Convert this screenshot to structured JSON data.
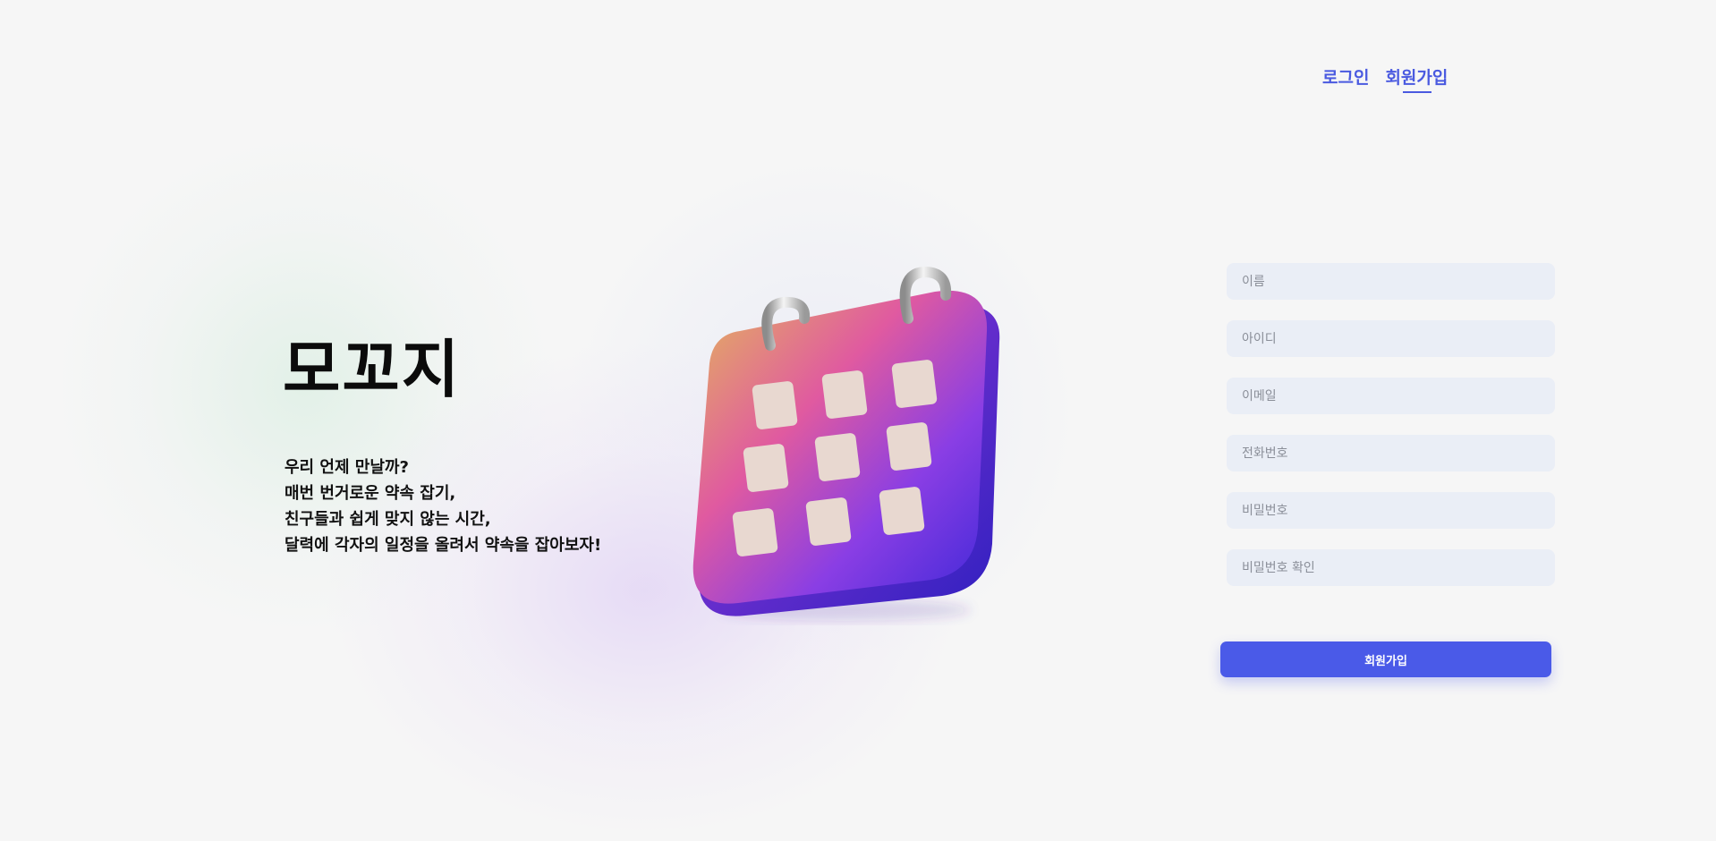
{
  "nav": {
    "login_label": "로그인",
    "signup_label": "회원가입"
  },
  "hero": {
    "title": "모꼬지",
    "tagline": [
      "우리 언제 만날까?",
      "매번 번거로운 약속 잡기,",
      "친구들과 쉽게 맞지 않는 시간,",
      "달력에 각자의 일정을 올려서 약속을 잡아보자!"
    ],
    "illustration_icon": "calendar-3d-icon"
  },
  "form": {
    "fields": [
      {
        "name": "name",
        "placeholder": "이름",
        "value": ""
      },
      {
        "name": "userid",
        "placeholder": "아이디",
        "value": ""
      },
      {
        "name": "email",
        "placeholder": "이메일",
        "value": ""
      },
      {
        "name": "phone",
        "placeholder": "전화번호",
        "value": ""
      },
      {
        "name": "password",
        "placeholder": "비밀번호",
        "value": ""
      },
      {
        "name": "password-confirm",
        "placeholder": "비밀번호 확인",
        "value": ""
      }
    ],
    "submit_label": "회원가입"
  },
  "colors": {
    "accent": "#4a5ae8",
    "nav_link": "#4a5ae0",
    "input_bg": "#eaeef6",
    "page_bg": "#f6f6f6",
    "calendar_gradient": [
      "#e2b05a",
      "#e0509c",
      "#7c35e0",
      "#3e28d8"
    ],
    "calendar_cell": "#e8d8d0"
  }
}
